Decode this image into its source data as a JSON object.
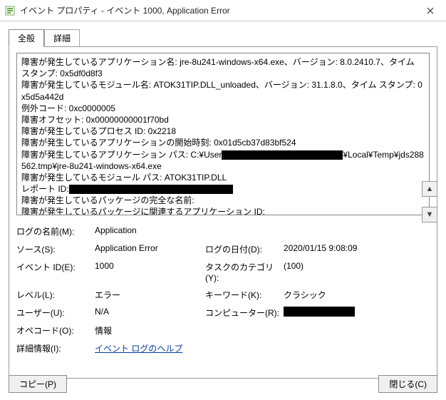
{
  "window": {
    "title": "イベント プロパティ - イベント 1000, Application Error"
  },
  "tabs": {
    "general": "全般",
    "details": "詳細"
  },
  "description": {
    "l1": "障害が発生しているアプリケーション名: jre-8u241-windows-x64.exe、バージョン: 8.0.2410.7、タイム スタンプ: 0x5df0d8f3",
    "l2": "障害が発生しているモジュール名: ATOK31TIP.DLL_unloaded、バージョン: 31.1.8.0、タイム スタンプ: 0x5d5a442d",
    "l3": "例外コード: 0xc0000005",
    "l4": "障害オフセット: 0x00000000001f70bd",
    "l5": "障害が発生しているプロセス ID: 0x2218",
    "l6": "障害が発生しているアプリケーションの開始時刻: 0x01d5cb37d83bf524",
    "l7a": "障害が発生しているアプリケーション パス: C:¥User",
    "l7b": "¥Local¥Temp¥jds288562.tmp¥jre-8u241-windows-x64.exe",
    "l8": "障害が発生しているモジュール パス: ATOK31TIP.DLL",
    "l9": "レポート ID:",
    "l10": "障害が発生しているパッケージの完全な名前:",
    "l11": "障害が発生しているパッケージに関連するアプリケーション ID:"
  },
  "props": {
    "log_label": "ログの名前(M):",
    "log_value": "Application",
    "source_label": "ソース(S):",
    "source_value": "Application Error",
    "date_label": "ログの日付(D):",
    "date_value": "2020/01/15 9:08:09",
    "eventid_label": "イベント ID(E):",
    "eventid_value": "1000",
    "taskcat_label": "タスクのカテゴリ(Y):",
    "taskcat_value": "(100)",
    "level_label": "レベル(L):",
    "level_value": "エラー",
    "keywords_label": "キーワード(K):",
    "keywords_value": "クラシック",
    "user_label": "ユーザー(U):",
    "user_value": "N/A",
    "computer_label": "コンピューター(R):",
    "opcode_label": "オペコード(O):",
    "opcode_value": "情報",
    "moreinfo_label": "詳細情報(I):",
    "moreinfo_value": "イベント ログのヘルプ"
  },
  "buttons": {
    "copy": "コピー(P)",
    "close": "閉じる(C)"
  }
}
